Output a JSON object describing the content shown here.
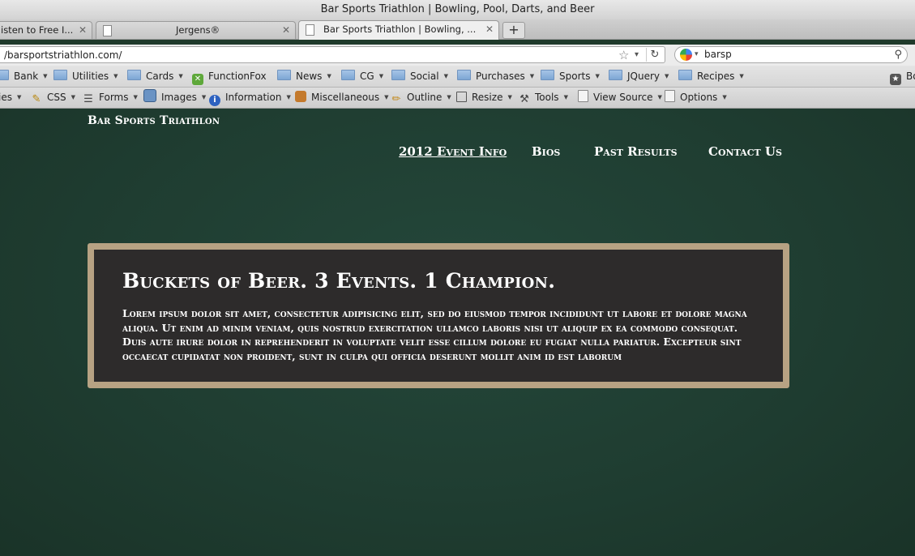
{
  "window": {
    "title": "Bar Sports Triathlon | Bowling, Pool, Darts, and Beer"
  },
  "tabs": [
    {
      "label": "isten to Free I...",
      "close": "✕"
    },
    {
      "label": "Jergens®",
      "close": "✕"
    },
    {
      "label": "Bar Sports Triathlon | Bowling, ...",
      "close": "✕"
    }
  ],
  "new_tab_label": "+",
  "address": {
    "url": "/barsportstriathlon.com/",
    "star": "☆",
    "dropdown": "▾",
    "reload": "↻"
  },
  "search": {
    "value": "barsp",
    "dropdown": "▾",
    "icon": "⚲"
  },
  "bookmarks": [
    {
      "label": "Bank",
      "icon": "folder"
    },
    {
      "label": "Utilities",
      "icon": "folder"
    },
    {
      "label": "Cards",
      "icon": "folder"
    },
    {
      "label": "FunctionFox",
      "icon": "functionfox-icon"
    },
    {
      "label": "News",
      "icon": "folder"
    },
    {
      "label": "CG",
      "icon": "folder"
    },
    {
      "label": "Social",
      "icon": "folder"
    },
    {
      "label": "Purchases",
      "icon": "folder"
    },
    {
      "label": "Sports",
      "icon": "folder"
    },
    {
      "label": "JQuery",
      "icon": "folder"
    },
    {
      "label": "Recipes",
      "icon": "folder"
    },
    {
      "label": "Bo",
      "icon": "bookmark-star-icon"
    }
  ],
  "devtools": [
    {
      "label": "ies",
      "icon": ""
    },
    {
      "label": "CSS",
      "icon": "css-pencil-icon"
    },
    {
      "label": "Forms",
      "icon": "forms-icon"
    },
    {
      "label": "Images",
      "icon": "images-icon"
    },
    {
      "label": "Information",
      "icon": "information-icon"
    },
    {
      "label": "Miscellaneous",
      "icon": "miscellaneous-icon"
    },
    {
      "label": "Outline",
      "icon": "outline-pencil-icon"
    },
    {
      "label": "Resize",
      "icon": "resize-icon"
    },
    {
      "label": "Tools",
      "icon": "tools-icon"
    },
    {
      "label": "View Source",
      "icon": "view-source-icon"
    },
    {
      "label": "Options",
      "icon": "options-icon"
    }
  ],
  "site": {
    "title": "Bar Sports Triathlon",
    "nav": [
      "2012 Event Info",
      "Bios",
      "Past Results",
      "Contact Us"
    ],
    "hero_title": "Buckets of Beer. 3 Events. 1 Champion.",
    "hero_body": "Lorem ipsum dolor sit amet, consectetur adipisicing elit, sed do eiusmod tempor incididunt ut labore et dolore magna aliqua. Ut enim ad minim veniam, quis nostrud exercitation ullamco laboris nisi ut aliquip ex ea commodo consequat. Duis aute irure dolor in reprehenderit in voluptate velit esse cillum dolore eu fugiat nulla pariatur. Excepteur sint occaecat cupidatat non proident, sunt in culpa qui officia deserunt mollit anim id est laborum"
  },
  "colors": {
    "page_background": "#1f3d31",
    "hero_background": "#2d2b2b",
    "hero_border": "#b7a283",
    "text": "#ffffff"
  }
}
